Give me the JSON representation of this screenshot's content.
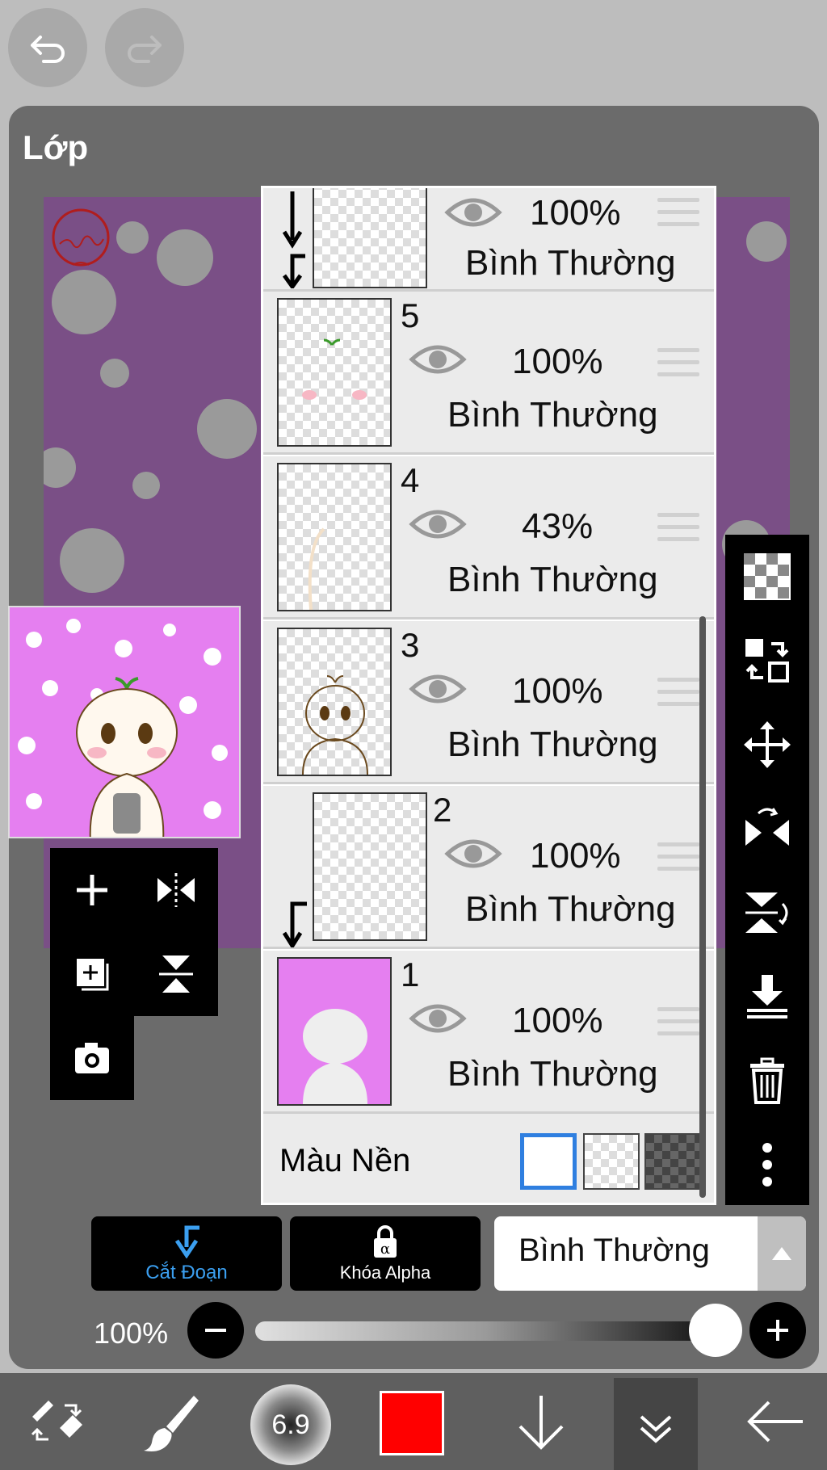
{
  "toolbar": {
    "undo_icon": "undo-icon",
    "redo_icon": "redo-icon"
  },
  "panel": {
    "title": "Lớp"
  },
  "layers": [
    {
      "number": "",
      "opacity": "100%",
      "blend": "Bình Thường",
      "clipped": true
    },
    {
      "number": "5",
      "opacity": "100%",
      "blend": "Bình Thường",
      "clipped": false
    },
    {
      "number": "4",
      "opacity": "43%",
      "blend": "Bình Thường",
      "clipped": false
    },
    {
      "number": "3",
      "opacity": "100%",
      "blend": "Bình Thường",
      "clipped": false
    },
    {
      "number": "2",
      "opacity": "100%",
      "blend": "Bình Thường",
      "clipped": true
    },
    {
      "number": "1",
      "opacity": "100%",
      "blend": "Bình Thường",
      "clipped": false
    }
  ],
  "background": {
    "label": "Màu Nền",
    "options": [
      "white",
      "transparent",
      "dark-checker"
    ],
    "selected": "white"
  },
  "actions": {
    "clip_label": "Cắt Đoạn",
    "alpha_lock_label": "Khóa Alpha",
    "blend_mode": "Bình Thường"
  },
  "opacity_control": {
    "value_label": "100%",
    "value": 1.0
  },
  "brush": {
    "size_label": "6.9"
  },
  "colors": {
    "current": "#ff0000",
    "accent": "#2f7fe0",
    "canvas_bg": "#7a4f86",
    "thumb_bg": "#e57ff0"
  }
}
